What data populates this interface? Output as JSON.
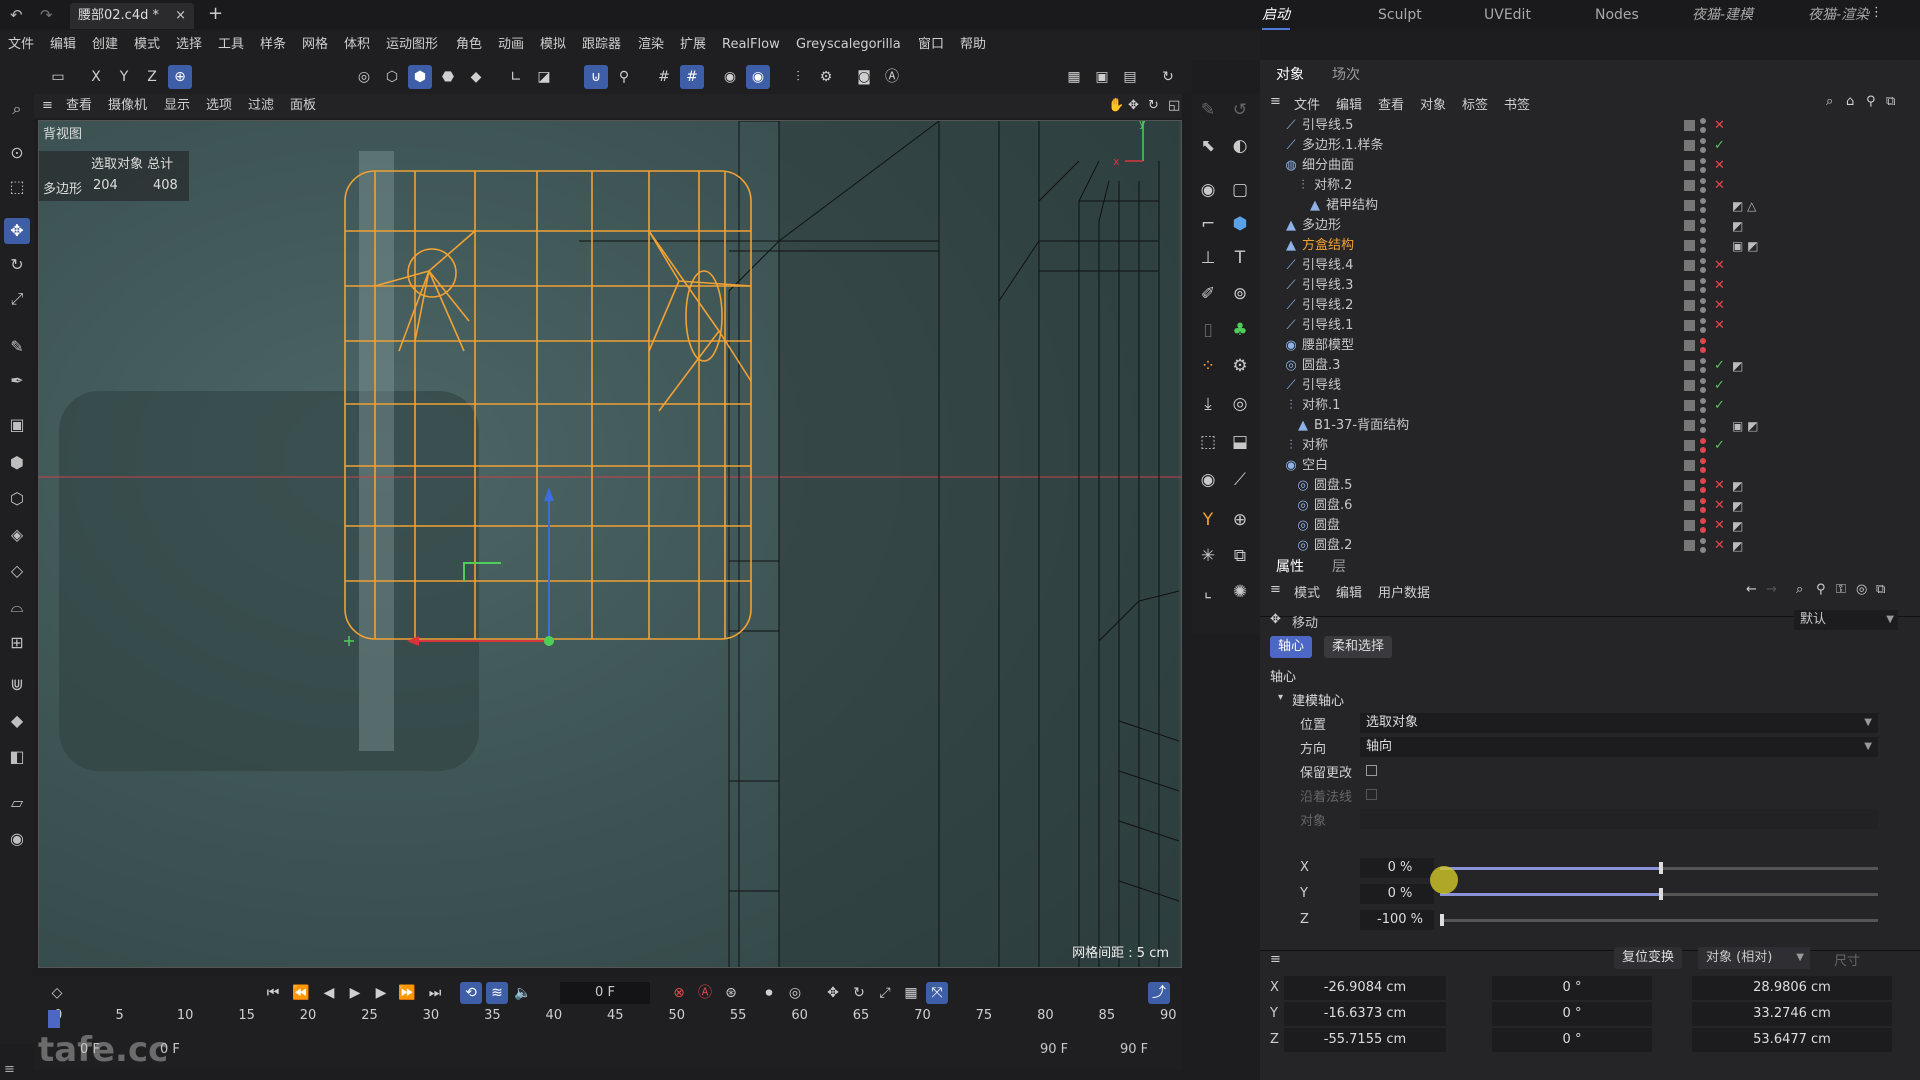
{
  "titlebar": {
    "doc_tab": "腰部02.c4d *",
    "new_tab": "+",
    "layouts": [
      "启动",
      "Sculpt",
      "UVEdit",
      "Nodes",
      "夜猫-建模",
      "夜猫-渲染"
    ],
    "more": "⋮"
  },
  "menu": [
    "文件",
    "编辑",
    "创建",
    "模式",
    "选择",
    "工具",
    "样条",
    "网格",
    "体积",
    "运动图形",
    "角色",
    "动画",
    "模拟",
    "跟踪器",
    "渲染",
    "扩展",
    "RealFlow",
    "Greyscalegorilla",
    "窗口",
    "帮助"
  ],
  "axis_lock": [
    "X",
    "Y",
    "Z"
  ],
  "viewport": {
    "menu": [
      "查看",
      "摄像机",
      "显示",
      "选项",
      "过滤",
      "面板"
    ],
    "label": "背视图",
    "stats_header": "选取对象 总计",
    "stats_row_label": "多边形",
    "stats_selected": "204",
    "stats_total": "408",
    "grid_distance": "网格间距 : 5 cm",
    "bg_color": "#3c5252",
    "wire_color": "#f0a235"
  },
  "objects_panel": {
    "tabs": [
      "对象",
      "场次"
    ],
    "menu": [
      "文件",
      "编辑",
      "查看",
      "对象",
      "标签",
      "书签"
    ],
    "rows": [
      {
        "name": "引导线.5",
        "indent": 0,
        "icon": "spline-icon",
        "mark": "x",
        "tags": ""
      },
      {
        "name": "多边形.1.样条",
        "indent": 0,
        "icon": "spline-icon",
        "mark": "ok",
        "tags": ""
      },
      {
        "name": "细分曲面",
        "indent": 0,
        "icon": "subdivision-icon",
        "mark": "x",
        "tags": ""
      },
      {
        "name": "对称.2",
        "indent": 1,
        "icon": "symmetry-icon",
        "mark": "x",
        "tags": ""
      },
      {
        "name": "裙甲结构",
        "indent": 2,
        "icon": "polygon-icon",
        "mark": "",
        "tags": "◩ △"
      },
      {
        "name": "多边形",
        "indent": 0,
        "icon": "polygon-icon",
        "mark": "",
        "tags": "◩"
      },
      {
        "name": "方盒结构",
        "indent": 0,
        "icon": "polygon-icon",
        "mark": "",
        "tags": "▣ ◩",
        "highlight": true
      },
      {
        "name": "引导线.4",
        "indent": 0,
        "icon": "spline-icon",
        "mark": "x",
        "tags": ""
      },
      {
        "name": "引导线.3",
        "indent": 0,
        "icon": "spline-icon",
        "mark": "x",
        "tags": ""
      },
      {
        "name": "引导线.2",
        "indent": 0,
        "icon": "spline-icon",
        "mark": "x",
        "tags": ""
      },
      {
        "name": "引导线.1",
        "indent": 0,
        "icon": "spline-icon",
        "mark": "x",
        "tags": ""
      },
      {
        "name": "腰部模型",
        "indent": 0,
        "icon": "null-icon",
        "mark": "",
        "tags": ""
      },
      {
        "name": "圆盘.3",
        "indent": 0,
        "icon": "disc-icon",
        "mark": "ok",
        "tags": "◩"
      },
      {
        "name": "引导线",
        "indent": 0,
        "icon": "spline-icon",
        "mark": "ok",
        "tags": ""
      },
      {
        "name": "对称.1",
        "indent": 0,
        "icon": "symmetry-icon",
        "mark": "ok",
        "tags": ""
      },
      {
        "name": "B1-37-背面结构",
        "indent": 1,
        "icon": "polygon-icon",
        "mark": "",
        "tags": "▣ ◩"
      },
      {
        "name": "对称",
        "indent": 0,
        "icon": "symmetry-icon",
        "mark": "ok",
        "tags": ""
      },
      {
        "name": "空白",
        "indent": 0,
        "icon": "null-icon",
        "mark": "",
        "tags": ""
      },
      {
        "name": "圆盘.5",
        "indent": 1,
        "icon": "disc-icon",
        "mark": "x",
        "tags": "◩"
      },
      {
        "name": "圆盘.6",
        "indent": 1,
        "icon": "disc-icon",
        "mark": "x",
        "tags": "◩"
      },
      {
        "name": "圆盘",
        "indent": 1,
        "icon": "disc-icon",
        "mark": "x",
        "tags": "◩"
      },
      {
        "name": "圆盘.2",
        "indent": 1,
        "icon": "disc-icon",
        "mark": "x",
        "tags": "◩"
      }
    ]
  },
  "attributes": {
    "tabs": [
      "属性",
      "层"
    ],
    "menu": [
      "模式",
      "编辑",
      "用户数据"
    ],
    "tool_name": "移动",
    "preset": "默认",
    "subtabs": [
      "轴心",
      "柔和选择"
    ],
    "section": "轴心",
    "group": "建模轴心",
    "position_label": "位置",
    "position_value": "选取对象",
    "direction_label": "方向",
    "direction_value": "轴向",
    "keep_label": "保留更改",
    "along_label": "沿着法线",
    "object_label": "对象",
    "xyz": [
      {
        "axis": "X",
        "value": "0 %",
        "fill": 0.5
      },
      {
        "axis": "Y",
        "value": "0 %",
        "fill": 0.5
      },
      {
        "axis": "Z",
        "value": "-100 %",
        "fill": 0.0
      }
    ]
  },
  "coords": {
    "reset_button": "复位变换",
    "mode": "对象 (相对)",
    "size_label": "尺寸",
    "rows": [
      {
        "axis": "X",
        "pos": "-26.9084 cm",
        "rot": "0 °",
        "size": "28.9806 cm"
      },
      {
        "axis": "Y",
        "pos": "-16.6373 cm",
        "rot": "0 °",
        "size": "33.2746 cm"
      },
      {
        "axis": "Z",
        "pos": "-55.7155 cm",
        "rot": "0 °",
        "size": "53.6477 cm"
      }
    ]
  },
  "timeline": {
    "current_frame": "0 F",
    "ticks": [
      "0",
      "5",
      "10",
      "15",
      "20",
      "25",
      "30",
      "35",
      "40",
      "45",
      "50",
      "55",
      "60",
      "65",
      "70",
      "75",
      "80",
      "85",
      "90"
    ],
    "start": "0 F",
    "start2": "0 F",
    "end": "90 F",
    "end2": "90 F"
  },
  "watermark": "tafe.cc"
}
